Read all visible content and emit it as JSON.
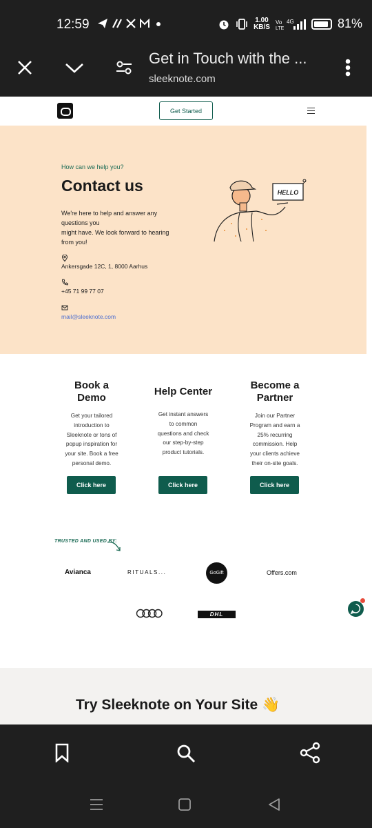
{
  "status_bar": {
    "time": "12:59",
    "net_speed_top": "1.00",
    "net_speed_bottom": "KB/S",
    "battery": "81%"
  },
  "browser": {
    "page_title": "Get in Touch with the ...",
    "url": "sleeknote.com"
  },
  "site_header": {
    "cta_label": "Get Started"
  },
  "hero": {
    "eyebrow": "How can we help you?",
    "title": "Contact us",
    "intro_line1": "We're here to help and answer any",
    "intro_line2": "questions you",
    "intro_line3": "might have. We look forward to hearing",
    "intro_line4": "from you!",
    "address": "Ankersgade 12C, 1, 8000 Aarhus",
    "phone": "+45 71 99 77 07",
    "email": "mail@sleeknote.com",
    "sign_text": "HELLO"
  },
  "cards": [
    {
      "title_line1": "Book a",
      "title_line2": "Demo",
      "body": [
        "Get your tailored",
        "introduction to",
        "Sleeknote or tons of",
        "popup inspiration for",
        "your site. Book a free",
        "personal demo."
      ],
      "button": "Click here"
    },
    {
      "title_line1": "Help Center",
      "title_line2": "",
      "body": [
        "Get instant answers",
        "to common",
        "questions and check",
        "our step-by-step",
        "product tutorials."
      ],
      "button": "Click here"
    },
    {
      "title_line1": "Become a",
      "title_line2": "Partner",
      "body": [
        "Join our Partner",
        "Program and earn a",
        "25% recurring",
        "commission. Help",
        "your clients achieve",
        "their on-site goals."
      ],
      "button": "Click here"
    }
  ],
  "trusted": {
    "label": "TRUSTED AND USED BY:",
    "brands": [
      "Avianca",
      "RITUALS...",
      "GoGift",
      "Offers.com",
      "DHL"
    ]
  },
  "try_section": {
    "title": "Try Sleeknote on Your Site 👋"
  },
  "colors": {
    "accent": "#0f5c4d",
    "hero_bg": "#fce3c8",
    "link": "#4d6fd0",
    "chrome_bg": "#1f1f1f"
  }
}
